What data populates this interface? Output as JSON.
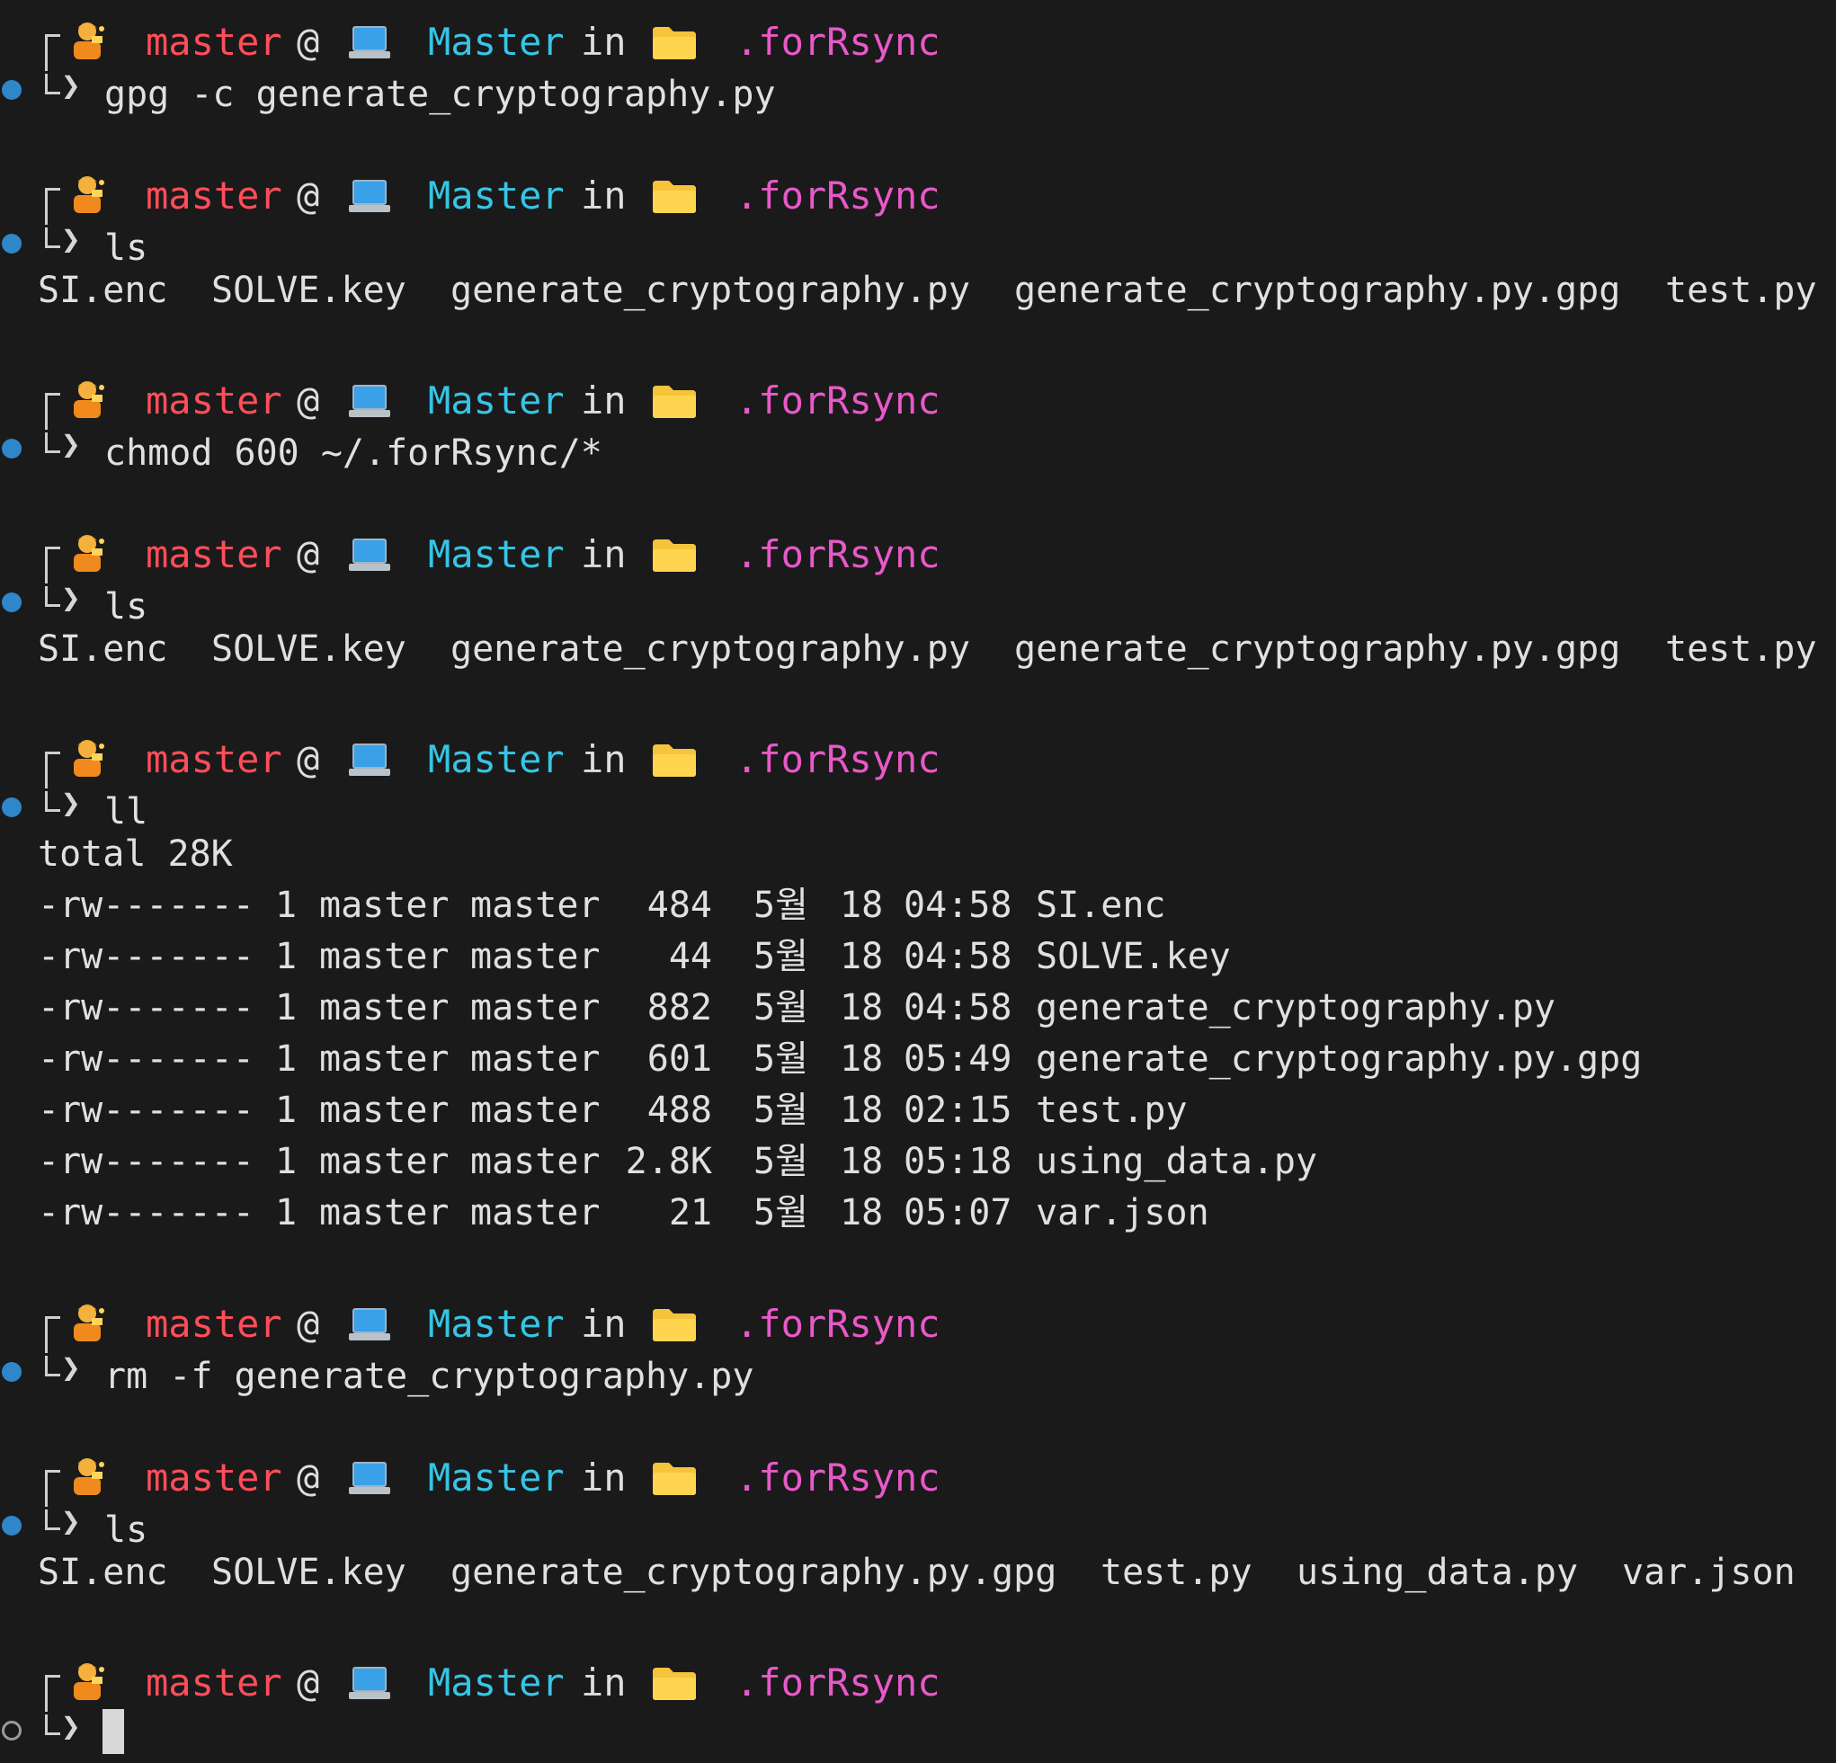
{
  "prompt": {
    "user": "master",
    "at": "@",
    "host": "Master",
    "in": "in",
    "dir": ".forRsync",
    "chevron": "❯",
    "icons": {
      "user": "person-technologist-emoji",
      "host": "laptop-emoji",
      "dir": "folder-emoji"
    }
  },
  "blocks": [
    {
      "command": "gpg -c generate_cryptography.py",
      "ls_output": [],
      "ll_output": null
    },
    {
      "command": "ls",
      "ls_output": [
        "SI.enc",
        "SOLVE.key",
        "generate_cryptography.py",
        "generate_cryptography.py.gpg",
        "test.py"
      ]
    },
    {
      "command": "chmod 600 ~/.forRsync/*",
      "ls_output": []
    },
    {
      "command": "ls",
      "ls_output": [
        "SI.enc",
        "SOLVE.key",
        "generate_cryptography.py",
        "generate_cryptography.py.gpg",
        "test.py"
      ]
    },
    {
      "command": "ll",
      "ll_total": "total 28K",
      "ll_rows": [
        {
          "perm": "-rw-------",
          "links": "1",
          "owner": "master",
          "group": "master",
          "size": "484",
          "month": "5월",
          "day": "18",
          "time": "04:58",
          "name": "SI.enc"
        },
        {
          "perm": "-rw-------",
          "links": "1",
          "owner": "master",
          "group": "master",
          "size": "44",
          "month": "5월",
          "day": "18",
          "time": "04:58",
          "name": "SOLVE.key"
        },
        {
          "perm": "-rw-------",
          "links": "1",
          "owner": "master",
          "group": "master",
          "size": "882",
          "month": "5월",
          "day": "18",
          "time": "04:58",
          "name": "generate_cryptography.py"
        },
        {
          "perm": "-rw-------",
          "links": "1",
          "owner": "master",
          "group": "master",
          "size": "601",
          "month": "5월",
          "day": "18",
          "time": "05:49",
          "name": "generate_cryptography.py.gpg"
        },
        {
          "perm": "-rw-------",
          "links": "1",
          "owner": "master",
          "group": "master",
          "size": "488",
          "month": "5월",
          "day": "18",
          "time": "02:15",
          "name": "test.py"
        },
        {
          "perm": "-rw-------",
          "links": "1",
          "owner": "master",
          "group": "master",
          "size": "2.8K",
          "month": "5월",
          "day": "18",
          "time": "05:18",
          "name": "using_data.py"
        },
        {
          "perm": "-rw-------",
          "links": "1",
          "owner": "master",
          "group": "master",
          "size": "21",
          "month": "5월",
          "day": "18",
          "time": "05:07",
          "name": "var.json"
        }
      ]
    },
    {
      "command": "rm -f generate_cryptography.py",
      "ls_output": []
    },
    {
      "command": "ls",
      "ls_output": [
        "SI.enc",
        "SOLVE.key",
        "generate_cryptography.py.gpg",
        "test.py",
        "using_data.py",
        "var.json"
      ]
    },
    {
      "command": "",
      "ls_output": [],
      "active": true
    }
  ],
  "colors": {
    "background": "#1a1a1a",
    "user": "#ff4d5a",
    "host": "#36c5e5",
    "dir": "#e859c8",
    "status_dot": "#2f86c9"
  }
}
